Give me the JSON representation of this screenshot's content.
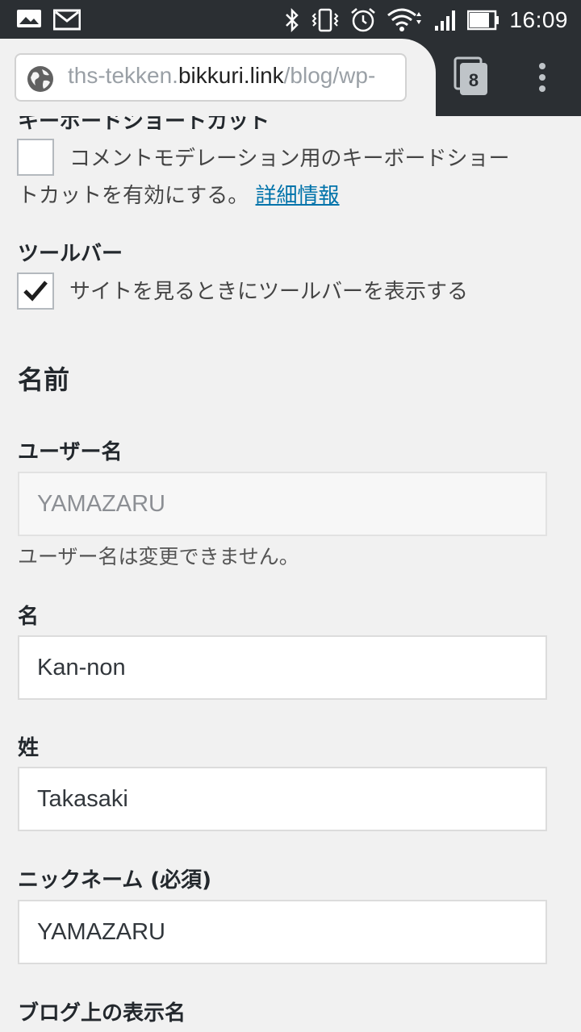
{
  "status_bar": {
    "time": "16:09",
    "left_icons": [
      "image-icon",
      "gmail-icon"
    ],
    "right_icons": [
      "bluetooth-icon",
      "vibrate-icon",
      "alarm-icon",
      "wifi-icon",
      "signal-icon",
      "battery-icon"
    ]
  },
  "browser": {
    "url_host": "ths-tekken.",
    "url_domain": "bikkuri.link",
    "url_path": "/blog/wp-",
    "tab_count": "8"
  },
  "form": {
    "keyboard_shortcuts": {
      "title": "キーボードショートカット",
      "checkbox_label": "コメントモデレーション用のキーボードショー",
      "checkbox_label_cont": "トカットを有効にする。",
      "link_text": "詳細情報",
      "checked": false
    },
    "toolbar": {
      "title": "ツールバー",
      "checkbox_label": "サイトを見るときにツールバーを表示する",
      "checked": true
    },
    "name_section": {
      "title": "名前",
      "username_label": "ユーザー名",
      "username_value": "YAMAZARU",
      "username_note": "ユーザー名は変更できません。",
      "first_name_label": "名",
      "first_name_value": "Kan-non",
      "last_name_label": "姓",
      "last_name_value": "Takasaki",
      "nickname_label": "ニックネーム (必須)",
      "nickname_value": "YAMAZARU",
      "display_name_label": "ブログ上の表示名"
    }
  }
}
